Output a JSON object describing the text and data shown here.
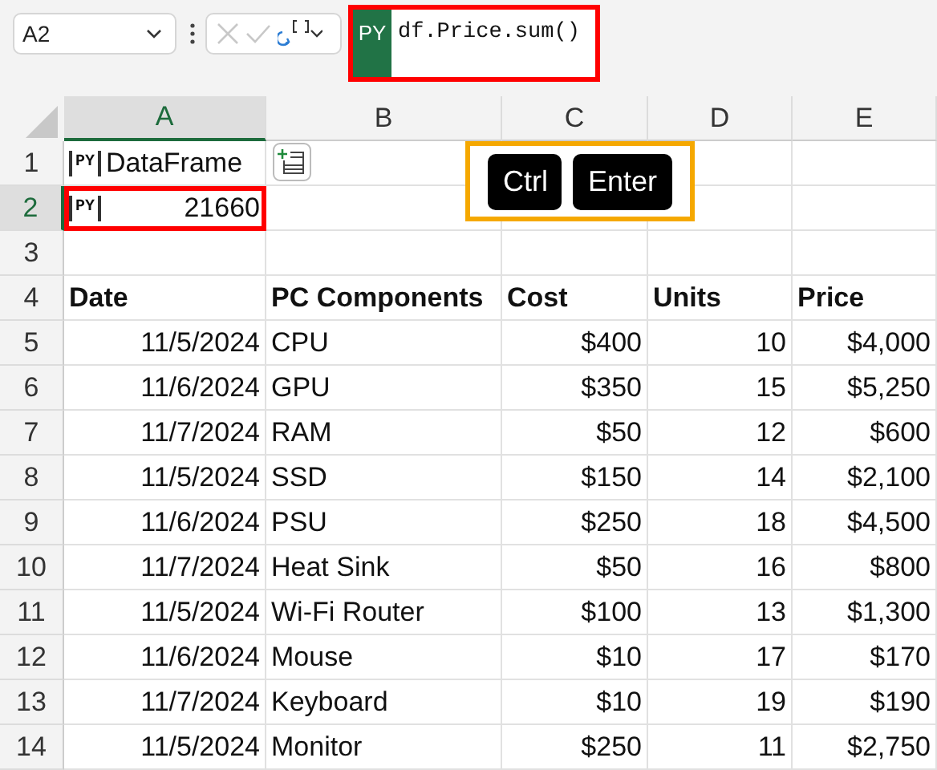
{
  "name_box": {
    "value": "A2"
  },
  "formula_bar": {
    "badge": "PY",
    "formula": "df.Price.sum()",
    "highlighted": true
  },
  "columns": [
    {
      "label": "A",
      "selected": true
    },
    {
      "label": "B",
      "selected": false
    },
    {
      "label": "C",
      "selected": false
    },
    {
      "label": "D",
      "selected": false
    },
    {
      "label": "E",
      "selected": false
    }
  ],
  "rows": [
    {
      "label": "1",
      "selected": false,
      "cells": [
        {
          "kind": "pylabel",
          "badge": "PY",
          "text": "DataFrame",
          "highlighted": false
        },
        {
          "kind": "empty"
        },
        {
          "kind": "covered"
        },
        {
          "kind": "empty"
        },
        {
          "kind": "empty"
        }
      ]
    },
    {
      "label": "2",
      "selected": true,
      "cells": [
        {
          "kind": "pyvalue",
          "badge": "PY",
          "text": "21660",
          "highlighted": true
        },
        {
          "kind": "empty"
        },
        {
          "kind": "empty"
        },
        {
          "kind": "empty"
        },
        {
          "kind": "empty"
        }
      ]
    },
    {
      "label": "3",
      "selected": false,
      "cells": [
        {
          "kind": "empty"
        },
        {
          "kind": "empty"
        },
        {
          "kind": "empty"
        },
        {
          "kind": "empty"
        },
        {
          "kind": "empty"
        }
      ]
    },
    {
      "label": "4",
      "selected": false,
      "cells": [
        {
          "kind": "header",
          "text": "Date"
        },
        {
          "kind": "header",
          "text": "PC Components"
        },
        {
          "kind": "header",
          "text": "Cost"
        },
        {
          "kind": "header",
          "text": "Units"
        },
        {
          "kind": "header",
          "text": "Price"
        }
      ]
    },
    {
      "label": "5",
      "selected": false,
      "cells": [
        {
          "kind": "number",
          "text": "11/5/2024"
        },
        {
          "kind": "text",
          "text": "CPU"
        },
        {
          "kind": "number",
          "text": "$400"
        },
        {
          "kind": "number",
          "text": "10"
        },
        {
          "kind": "number",
          "text": "$4,000"
        }
      ]
    },
    {
      "label": "6",
      "selected": false,
      "cells": [
        {
          "kind": "number",
          "text": "11/6/2024"
        },
        {
          "kind": "text",
          "text": "GPU"
        },
        {
          "kind": "number",
          "text": "$350"
        },
        {
          "kind": "number",
          "text": "15"
        },
        {
          "kind": "number",
          "text": "$5,250"
        }
      ]
    },
    {
      "label": "7",
      "selected": false,
      "cells": [
        {
          "kind": "number",
          "text": "11/7/2024"
        },
        {
          "kind": "text",
          "text": "RAM"
        },
        {
          "kind": "number",
          "text": "$50"
        },
        {
          "kind": "number",
          "text": "12"
        },
        {
          "kind": "number",
          "text": "$600"
        }
      ]
    },
    {
      "label": "8",
      "selected": false,
      "cells": [
        {
          "kind": "number",
          "text": "11/5/2024"
        },
        {
          "kind": "text",
          "text": "SSD"
        },
        {
          "kind": "number",
          "text": "$150"
        },
        {
          "kind": "number",
          "text": "14"
        },
        {
          "kind": "number",
          "text": "$2,100"
        }
      ]
    },
    {
      "label": "9",
      "selected": false,
      "cells": [
        {
          "kind": "number",
          "text": "11/6/2024"
        },
        {
          "kind": "text",
          "text": "PSU"
        },
        {
          "kind": "number",
          "text": "$250"
        },
        {
          "kind": "number",
          "text": "18"
        },
        {
          "kind": "number",
          "text": "$4,500"
        }
      ]
    },
    {
      "label": "10",
      "selected": false,
      "cells": [
        {
          "kind": "number",
          "text": "11/7/2024"
        },
        {
          "kind": "text",
          "text": "Heat Sink"
        },
        {
          "kind": "number",
          "text": "$50"
        },
        {
          "kind": "number",
          "text": "16"
        },
        {
          "kind": "number",
          "text": "$800"
        }
      ]
    },
    {
      "label": "11",
      "selected": false,
      "cells": [
        {
          "kind": "number",
          "text": "11/5/2024"
        },
        {
          "kind": "text",
          "text": "Wi-Fi Router"
        },
        {
          "kind": "number",
          "text": "$100"
        },
        {
          "kind": "number",
          "text": "13"
        },
        {
          "kind": "number",
          "text": "$1,300"
        }
      ]
    },
    {
      "label": "12",
      "selected": false,
      "cells": [
        {
          "kind": "number",
          "text": "11/6/2024"
        },
        {
          "kind": "text",
          "text": "Mouse"
        },
        {
          "kind": "number",
          "text": "$10"
        },
        {
          "kind": "number",
          "text": "17"
        },
        {
          "kind": "number",
          "text": "$170"
        }
      ]
    },
    {
      "label": "13",
      "selected": false,
      "cells": [
        {
          "kind": "number",
          "text": "11/7/2024"
        },
        {
          "kind": "text",
          "text": "Keyboard"
        },
        {
          "kind": "number",
          "text": "$10"
        },
        {
          "kind": "number",
          "text": "19"
        },
        {
          "kind": "number",
          "text": "$190"
        }
      ]
    },
    {
      "label": "14",
      "selected": false,
      "cells": [
        {
          "kind": "number",
          "text": "11/5/2024"
        },
        {
          "kind": "text",
          "text": "Monitor"
        },
        {
          "kind": "number",
          "text": "$250"
        },
        {
          "kind": "number",
          "text": "11"
        },
        {
          "kind": "number",
          "text": "$2,750"
        }
      ]
    }
  ],
  "shortcut": {
    "keys": [
      "Ctrl",
      "Enter"
    ]
  }
}
